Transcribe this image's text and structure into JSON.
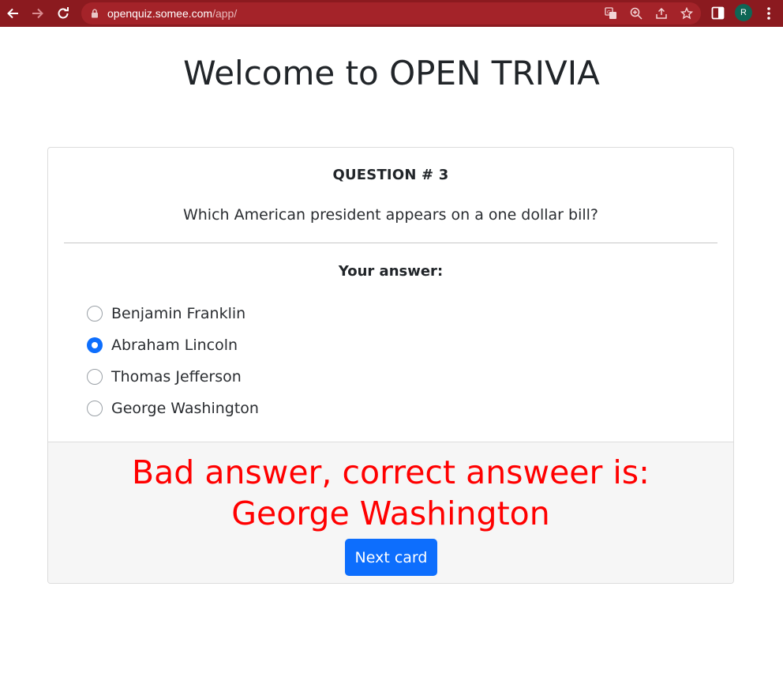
{
  "browser": {
    "url_host": "openquiz.somee.com",
    "url_path": "/app/",
    "profile_initial": "R",
    "icons": [
      "back-arrow-icon",
      "forward-arrow-icon",
      "reload-icon",
      "lock-icon",
      "translate-icon",
      "zoom-icon",
      "share-icon",
      "star-icon",
      "side-panel-icon",
      "kebab-menu-icon"
    ],
    "toolbar_color": "#8b1a1f"
  },
  "page": {
    "title": "Welcome to OPEN TRIVIA"
  },
  "quiz": {
    "question_number": "QUESTION # 3",
    "question_text": "Which American president appears on a one dollar bill?",
    "answer_heading": "Your answer:",
    "options": [
      {
        "label": "Benjamin Franklin",
        "selected": false
      },
      {
        "label": "Abraham Lincoln",
        "selected": true
      },
      {
        "label": "Thomas Jefferson",
        "selected": false
      },
      {
        "label": "George Washington",
        "selected": false
      }
    ],
    "result_message": "Bad answer, correct answeer is: George Washington",
    "result_color": "#ff0000",
    "next_button_label": "Next card",
    "accent_color": "#0d6efd"
  }
}
